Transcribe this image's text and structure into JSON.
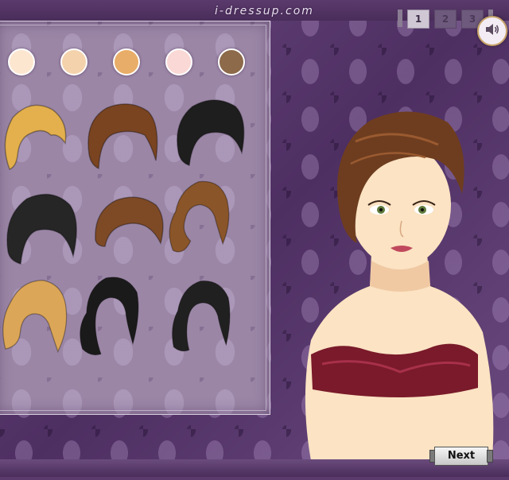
{
  "site": {
    "logo_text": "i-dressup.com"
  },
  "pager": {
    "pages": [
      "1",
      "2",
      "3"
    ],
    "active_page": "1"
  },
  "skin_swatches": [
    {
      "name": "skin-tone-1",
      "color": "#fde6d0"
    },
    {
      "name": "skin-tone-2",
      "color": "#f3d2ac"
    },
    {
      "name": "skin-tone-3",
      "color": "#e8ad68"
    },
    {
      "name": "skin-tone-4",
      "color": "#f9d8d6"
    },
    {
      "name": "skin-tone-5",
      "color": "#8c6a4a"
    }
  ],
  "hair_options": [
    {
      "name": "hair-blonde-short",
      "color": "#e3b04d"
    },
    {
      "name": "hair-brown-pixie",
      "color": "#7a4421"
    },
    {
      "name": "hair-black-updo",
      "color": "#1e1e1e"
    },
    {
      "name": "hair-black-bob",
      "color": "#262626"
    },
    {
      "name": "hair-brown-swept",
      "color": "#7e4a26"
    },
    {
      "name": "hair-brown-wavy",
      "color": "#8a5528"
    },
    {
      "name": "hair-blonde-curly",
      "color": "#dba657"
    },
    {
      "name": "hair-black-long-curly",
      "color": "#1a1a1a"
    },
    {
      "name": "hair-black-long-wavy",
      "color": "#202020"
    }
  ],
  "controls": {
    "next_label": "Next",
    "sound_icon": "speaker-icon"
  },
  "colors": {
    "background": "#5a3a6c",
    "panel": "#9b86a6",
    "bikini_top": "#7a1a2a",
    "skin": "#fbe3c3"
  }
}
